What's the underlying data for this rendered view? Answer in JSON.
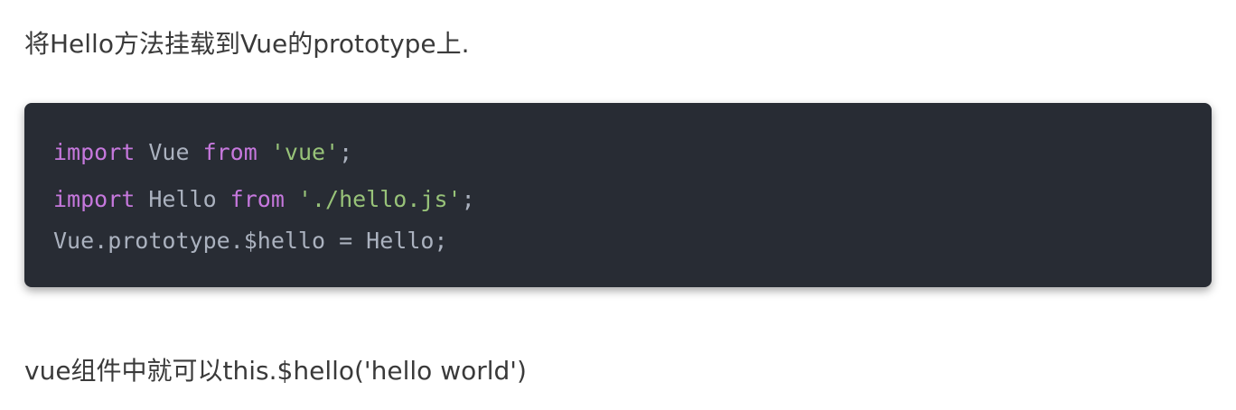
{
  "paragraphs": {
    "intro": "将Hello方法挂载到Vue的prototype上.",
    "outro": "vue组件中就可以this.$hello('hello world')"
  },
  "code_block": {
    "language": "javascript",
    "theme_colors": {
      "background": "#282c34",
      "keyword": "#c678dd",
      "string": "#98c379",
      "plain": "#abb2bf"
    },
    "lines": [
      {
        "tokens": [
          {
            "type": "keyword",
            "text": "import"
          },
          {
            "type": "plain",
            "text": " Vue "
          },
          {
            "type": "keyword",
            "text": "from"
          },
          {
            "type": "plain",
            "text": " "
          },
          {
            "type": "string",
            "text": "'vue'"
          },
          {
            "type": "plain",
            "text": ";"
          }
        ]
      },
      {
        "tokens": [
          {
            "type": "keyword",
            "text": "import"
          },
          {
            "type": "plain",
            "text": " Hello "
          },
          {
            "type": "keyword",
            "text": "from"
          },
          {
            "type": "plain",
            "text": " "
          },
          {
            "type": "string",
            "text": "'./hello.js'"
          },
          {
            "type": "plain",
            "text": ";"
          }
        ]
      },
      {
        "tokens": [
          {
            "type": "plain",
            "text": "Vue.prototype.$hello = Hello;"
          }
        ]
      }
    ]
  }
}
